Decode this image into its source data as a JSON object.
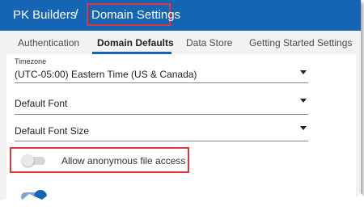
{
  "header": {
    "org_name": "PK Builders",
    "separator": "/",
    "page_title": "Domain Settings"
  },
  "tabs": [
    {
      "label": "Authentication",
      "active": false
    },
    {
      "label": "Domain Defaults",
      "active": true
    },
    {
      "label": "Data Store",
      "active": false
    },
    {
      "label": "Getting Started Settings",
      "active": false
    }
  ],
  "form": {
    "timezone": {
      "label": "Timezone",
      "value": "(UTC-05:00) Eastern Time (US & Canada)"
    },
    "font": {
      "value": "Default Font"
    },
    "font_size": {
      "value": "Default Font Size"
    },
    "anonymous_access": {
      "label": "Allow anonymous file access",
      "enabled": false
    },
    "second_toggle": {
      "enabled": true
    }
  },
  "colors": {
    "header_bg": "#1565b4",
    "highlight_red": "#e0383b",
    "accent_blue": "#1565b4"
  }
}
